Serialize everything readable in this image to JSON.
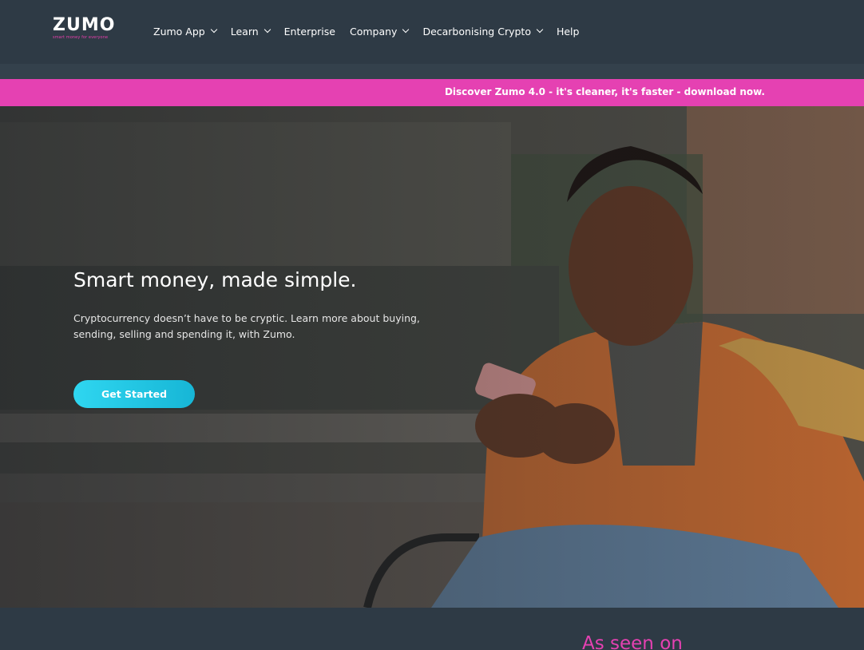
{
  "brand": {
    "name": "ZUMO",
    "tagline": "smart money for everyone",
    "accent": "#e541b2",
    "cta_color": "#1fc4e2"
  },
  "nav": {
    "items": [
      {
        "label": "Zumo App",
        "has_dropdown": true
      },
      {
        "label": "Learn",
        "has_dropdown": true
      },
      {
        "label": "Enterprise",
        "has_dropdown": false
      },
      {
        "label": "Company",
        "has_dropdown": true
      },
      {
        "label": "Decarbonising Crypto",
        "has_dropdown": true
      },
      {
        "label": "Help",
        "has_dropdown": false
      }
    ]
  },
  "promo": {
    "text": "Discover Zumo 4.0 - it's cleaner, it's faster - download now."
  },
  "hero": {
    "title": "Smart money, made simple.",
    "subtitle": "Cryptocurrency doesn’t have to be cryptic.  Learn more about buying, sending, selling and spending it, with Zumo.",
    "cta_label": "Get Started"
  },
  "footer": {
    "heading": "As seen on"
  }
}
